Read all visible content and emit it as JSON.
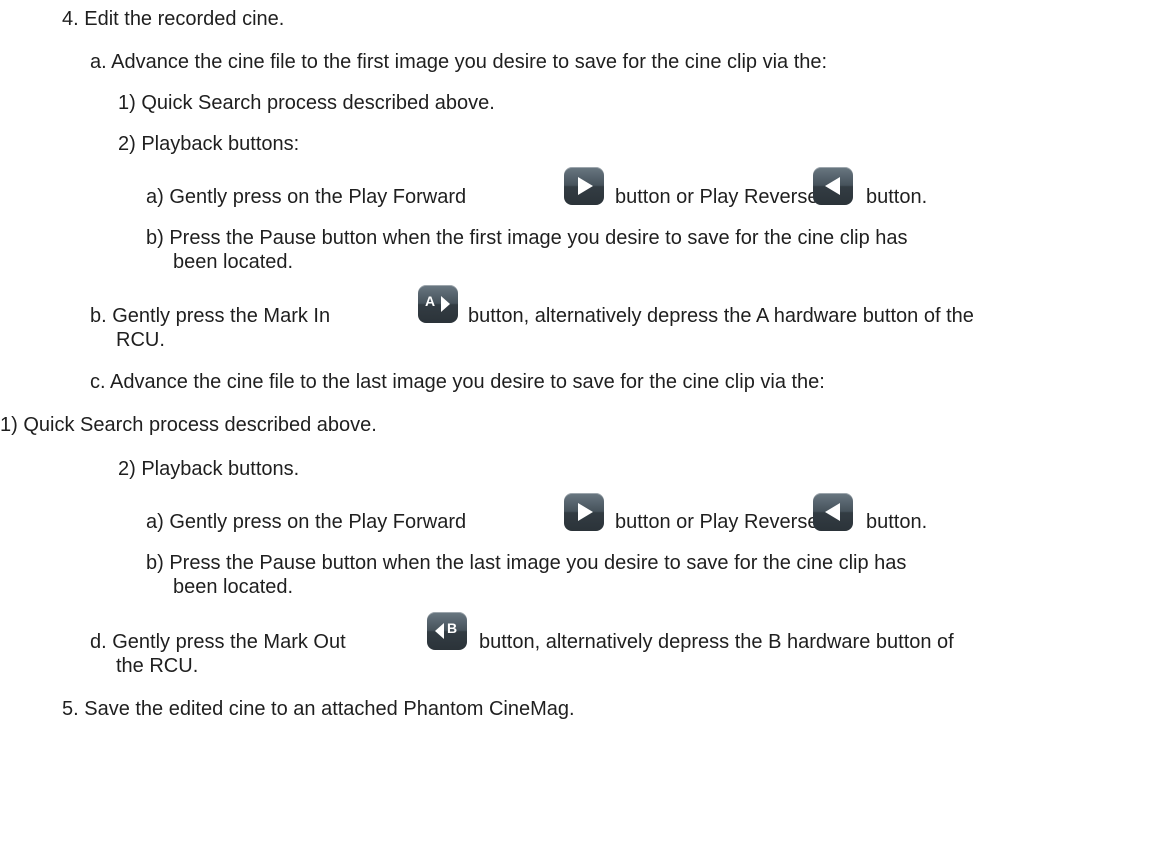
{
  "doc": {
    "s4": "4. Edit the recorded cine.",
    "s4a": "a. Advance the cine file to the first image you desire to save for the cine clip via the:",
    "s4a1": "1) Quick Search process described above.",
    "s4a2": "2) Playback buttons:",
    "s4a2a_pre": "a) Gently press on the Play Forward",
    "s4a2a_mid": "button or Play Reverse",
    "s4a2a_post": "button.",
    "s4a2b_l1": "b) Press the Pause button when the first image you desire to save for the cine clip has",
    "s4a2b_l2": "been located.",
    "s4b_pre": "b. Gently press the Mark In",
    "s4b_post": "button, alternatively depress the A hardware button of the",
    "s4b_l2": "RCU.",
    "s4c": "c. Advance the cine file to the last image you desire to save for the cine clip via the:",
    "s4c1": "1) Quick Search process described above.",
    "s4c2": "2) Playback buttons.",
    "s4c2a_pre": "a) Gently press on the Play Forward",
    "s4c2a_mid": "button or Play Reverse",
    "s4c2a_post": "button.",
    "s4c2b_l1": "b) Press the Pause button when the last image you desire to save for the cine clip has",
    "s4c2b_l2": "been located.",
    "s4d_pre": "d. Gently press the Mark Out",
    "s4d_post": "button, alternatively depress the B hardware button of",
    "s4d_l2": "the RCU.",
    "s5": "5. Save the edited cine to an attached Phantom CineMag."
  },
  "icons": {
    "mark_in_letter": "A",
    "mark_out_letter": "B",
    "names": [
      "play-forward-icon",
      "play-reverse-icon",
      "mark-in-icon",
      "mark-out-icon"
    ]
  }
}
